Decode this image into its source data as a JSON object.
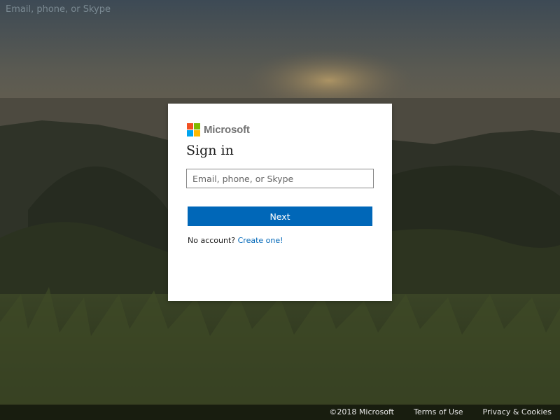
{
  "background": {
    "ghost_text": "Email, phone, or Skype"
  },
  "logo": {
    "text": "Microsoft",
    "colors": [
      "#f25022",
      "#7fba00",
      "#00a4ef",
      "#ffb900"
    ]
  },
  "signin": {
    "title": "Sign in",
    "email_placeholder": "Email, phone, or Skype",
    "email_value": "",
    "next_label": "Next",
    "no_account_text": "No account?",
    "create_link": "Create one!"
  },
  "footer": {
    "copyright": "©2018 Microsoft",
    "terms": "Terms of Use",
    "privacy": "Privacy & Cookies"
  },
  "colors": {
    "accent": "#0067b8"
  }
}
